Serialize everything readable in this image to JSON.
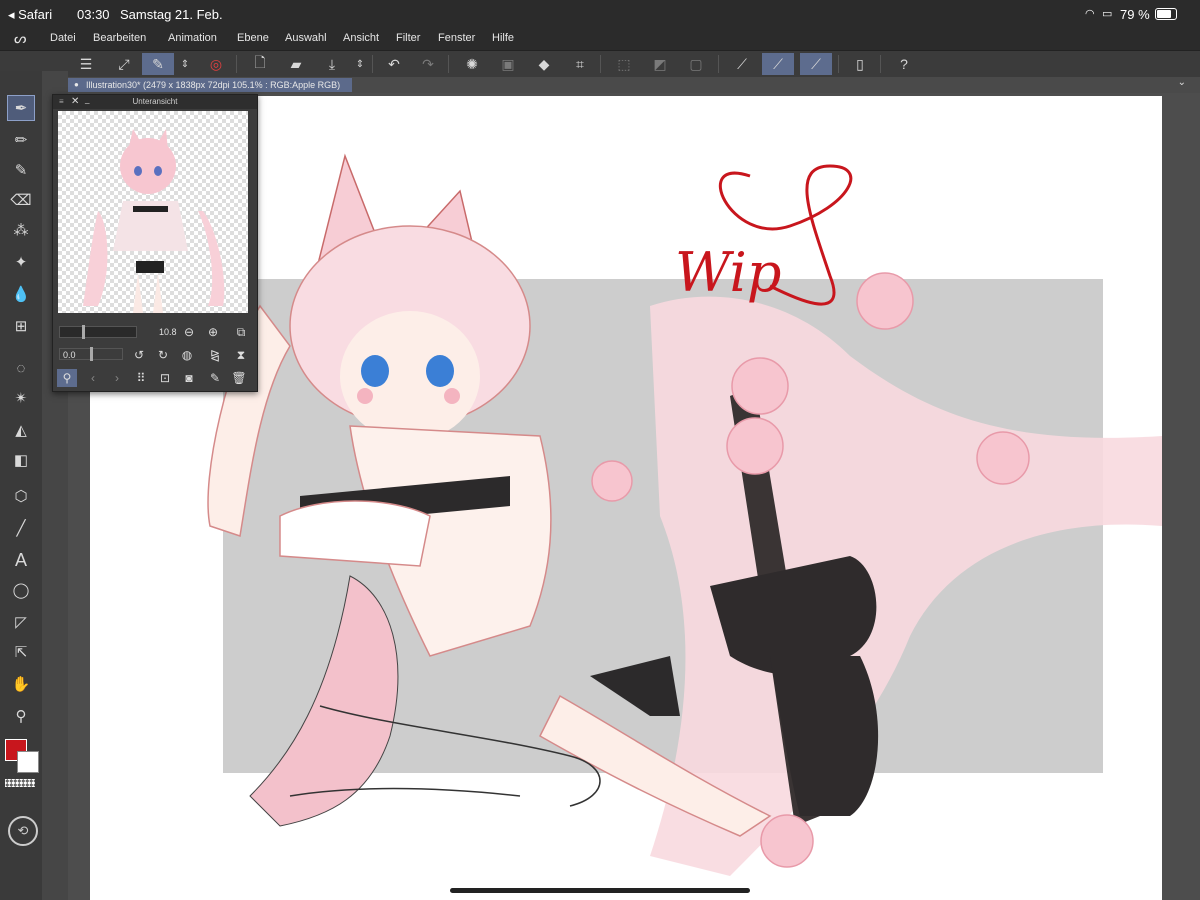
{
  "status": {
    "back_app": "Safari",
    "time": "03:30",
    "date": "Samstag 21. Feb.",
    "battery": "79 %"
  },
  "menu": [
    "Datei",
    "Bearbeiten",
    "Animation",
    "Ebene",
    "Auswahl",
    "Ansicht",
    "Filter",
    "Fenster",
    "Hilfe"
  ],
  "document": {
    "tab_title": "Illustration30* (2479 x 1838px 72dpi 105.1% : RGB:Apple RGB)"
  },
  "navigator": {
    "title": "Unteransicht",
    "zoom": "10.8",
    "rotation": "0.0"
  },
  "artwork": {
    "wip_text": "Wip"
  },
  "colors": {
    "main": "#c8161d",
    "sub": "#ffffff",
    "accent": "#5d6c8e"
  }
}
